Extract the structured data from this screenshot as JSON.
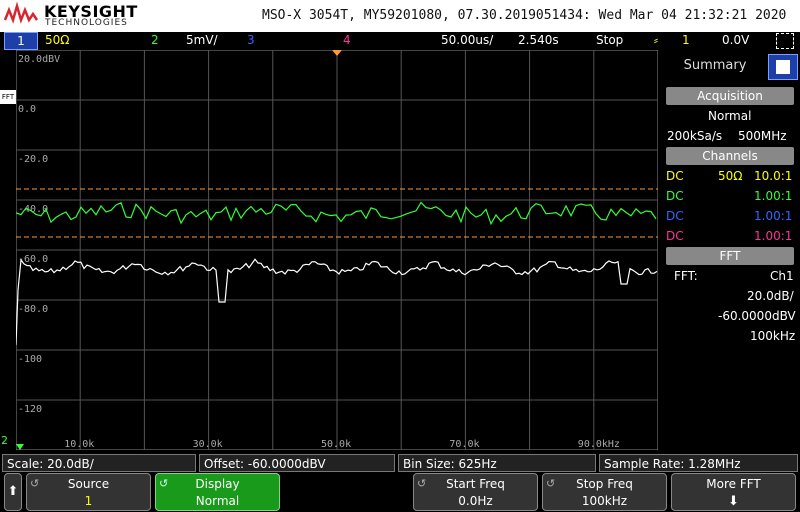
{
  "brand": {
    "name": "KEYSIGHT",
    "sub": "TECHNOLOGIES"
  },
  "title_info": "MSO-X 3054T, MY59201080, 07.30.2019051434: Wed Mar 04 21:32:21 2020",
  "status": {
    "ch1_label": "1",
    "ch1_value": "50Ω",
    "ch2_label": "2",
    "ch2_value": "5mV/",
    "ch3_label": "3",
    "ch4_label": "4",
    "timebase": "50.00us/",
    "delay": "2.540s",
    "run_state": "Stop",
    "trigger_channel": "1",
    "trigger_level": "0.0V"
  },
  "colors": {
    "ch1": "#ffff00",
    "ch2": "#33ff33",
    "ch3": "#3366ff",
    "ch4": "#ff3399",
    "fft": "#ffffff",
    "cursor": "#ff9933"
  },
  "y_axis": {
    "ticks": [
      "20.0dBV",
      "0.0",
      "-20.0",
      "-40.0",
      "-60.0",
      "-80.0",
      "-100",
      "-120"
    ]
  },
  "x_axis": {
    "ticks": [
      "10.0k",
      "30.0k",
      "50.0k",
      "70.0k",
      "90.0kHz"
    ]
  },
  "side_panel": {
    "tab": "Summary",
    "acquisition_header": "Acquisition",
    "acq_mode": "Normal",
    "sample_rate": "200kSa/s",
    "bandwidth": "500MHz",
    "channels_header": "Channels",
    "channels": [
      {
        "coupling": "DC",
        "impedance": "50Ω",
        "probe": "10.0:1",
        "color": "#ffff00"
      },
      {
        "coupling": "DC",
        "impedance": "",
        "probe": "1.00:1",
        "color": "#33ff33"
      },
      {
        "coupling": "DC",
        "impedance": "",
        "probe": "1.00:1",
        "color": "#3366ff"
      },
      {
        "coupling": "DC",
        "impedance": "",
        "probe": "1.00:1",
        "color": "#ff3399"
      }
    ],
    "fft_header": "FFT",
    "fft_label": "FFT:",
    "fft_source": "Ch1",
    "fft_scale": "20.0dB/",
    "fft_offset": "-60.0000dBV",
    "fft_span": "100kHz"
  },
  "info_bar": {
    "scale": "Scale: 20.0dB/",
    "offset": "Offset: -60.0000dBV",
    "bin_size": "Bin Size: 625Hz",
    "sample_rate": "Sample Rate: 1.28MHz"
  },
  "softkeys": {
    "source_label": "Source",
    "source_value": "1",
    "display_label": "Display",
    "display_value": "Normal",
    "start_freq_label": "Start Freq",
    "start_freq_value": "0.0Hz",
    "stop_freq_label": "Stop Freq",
    "stop_freq_value": "100kHz",
    "more_label": "More FFT"
  },
  "markers": {
    "fft_marker": "FFT",
    "ch2_ground": "2"
  }
}
